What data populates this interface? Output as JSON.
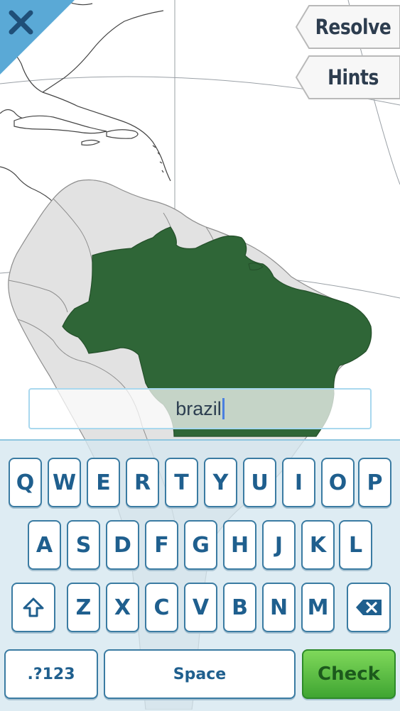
{
  "buttons": {
    "close_icon": "close-icon",
    "resolve_label": "Resolve",
    "hints_label": "Hints"
  },
  "answer": {
    "typed_text": "brazil"
  },
  "map": {
    "highlighted_country": "Brazil",
    "highlight_color": "#2f6637",
    "land_color": "#e2e2e2",
    "sea_color": "#ffffff"
  },
  "keyboard": {
    "row1": [
      "Q",
      "W",
      "E",
      "R",
      "T",
      "Y",
      "U",
      "I",
      "O",
      "P"
    ],
    "row2": [
      "A",
      "S",
      "D",
      "F",
      "G",
      "H",
      "J",
      "K",
      "L"
    ],
    "row3": [
      "Z",
      "X",
      "C",
      "V",
      "B",
      "N",
      "M"
    ],
    "shift_icon": "shift-icon",
    "backspace_icon": "backspace-icon",
    "numbers_label": ".?123",
    "space_label": "Space",
    "check_label": "Check"
  },
  "colors": {
    "accent_blue": "#5aa9d6",
    "key_text": "#1f5f8e",
    "check_green": "#4fb53a"
  }
}
